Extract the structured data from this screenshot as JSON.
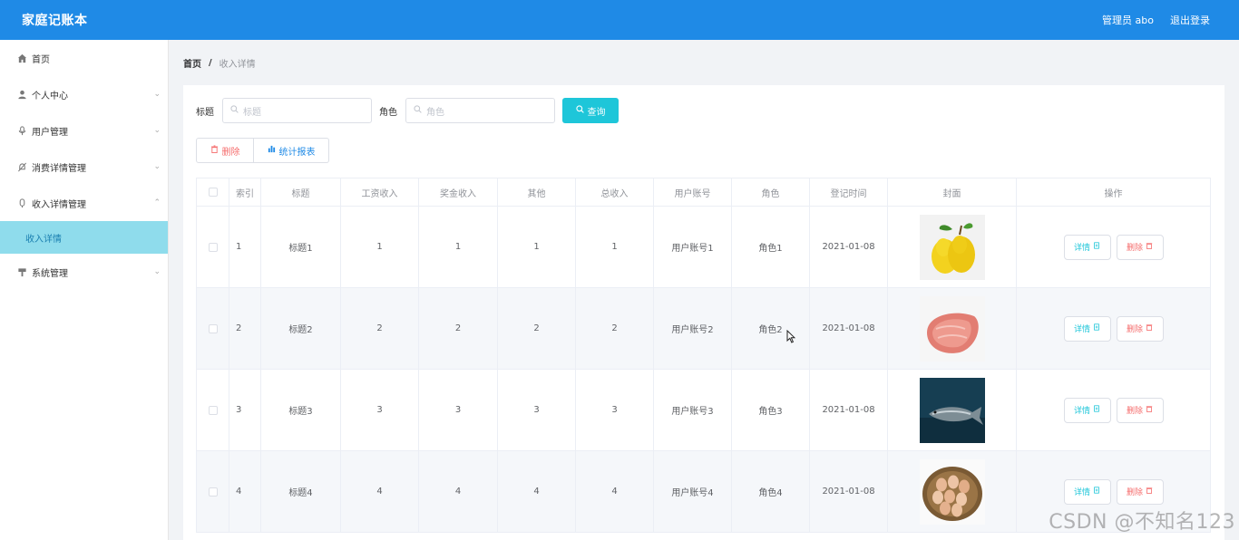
{
  "app": {
    "title": "家庭记账本"
  },
  "header": {
    "user_label": "管理员 abo",
    "logout_label": "退出登录"
  },
  "sidebar": {
    "items": [
      {
        "label": "首页",
        "icon": "home-icon",
        "expandable": false
      },
      {
        "label": "个人中心",
        "icon": "user-icon",
        "expandable": true
      },
      {
        "label": "用户管理",
        "icon": "microphone-icon",
        "expandable": true
      },
      {
        "label": "消费详情管理",
        "icon": "bell-off-icon",
        "expandable": true
      },
      {
        "label": "收入详情管理",
        "icon": "mic-icon",
        "expandable": true,
        "expanded": true
      },
      {
        "label": "系统管理",
        "icon": "stand-icon",
        "expandable": true
      }
    ],
    "submenu": {
      "label": "收入详情",
      "active": true
    }
  },
  "breadcrumb": {
    "home": "首页",
    "separator": "/",
    "current": "收入详情"
  },
  "search": {
    "title_label": "标题",
    "title_placeholder": "标题",
    "role_label": "角色",
    "role_placeholder": "角色",
    "query_label": "查询"
  },
  "actions": {
    "delete_label": "删除",
    "stats_label": "统计报表"
  },
  "table": {
    "headers": [
      "索引",
      "标题",
      "工资收入",
      "奖金收入",
      "其他",
      "总收入",
      "用户账号",
      "角色",
      "登记时间",
      "封面",
      "操作"
    ],
    "rows": [
      {
        "index": "1",
        "title": "标题1",
        "wage": "1",
        "bonus": "1",
        "other": "1",
        "total": "1",
        "account": "用户账号1",
        "role": "角色1",
        "date": "2021-01-08",
        "cover": "pears"
      },
      {
        "index": "2",
        "title": "标题2",
        "wage": "2",
        "bonus": "2",
        "other": "2",
        "total": "2",
        "account": "用户账号2",
        "role": "角色2",
        "date": "2021-01-08",
        "cover": "meat"
      },
      {
        "index": "3",
        "title": "标题3",
        "wage": "3",
        "bonus": "3",
        "other": "3",
        "total": "3",
        "account": "用户账号3",
        "role": "角色3",
        "date": "2021-01-08",
        "cover": "fish"
      },
      {
        "index": "4",
        "title": "标题4",
        "wage": "4",
        "bonus": "4",
        "other": "4",
        "total": "4",
        "account": "用户账号4",
        "role": "角色4",
        "date": "2021-01-08",
        "cover": "eggs"
      }
    ],
    "detail_label": "详情",
    "delete_label": "删除"
  },
  "watermark": "CSDN @不知名123",
  "colors": {
    "header_bg": "#1f8ae6",
    "accent": "#1ec6d9",
    "danger": "#f56c6c",
    "submenu_active": "#8fdcec"
  }
}
